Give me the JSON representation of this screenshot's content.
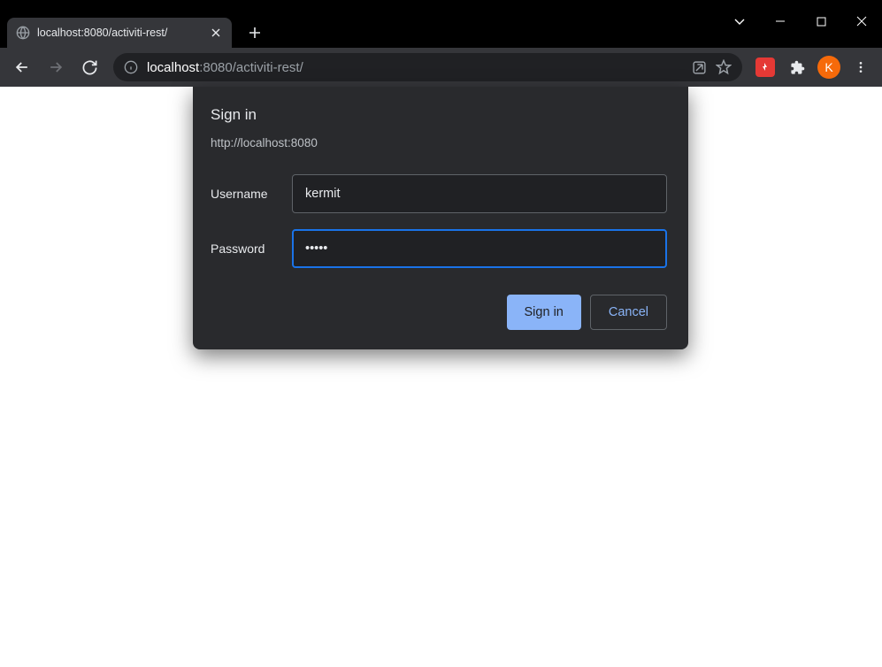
{
  "tab": {
    "title": "localhost:8080/activiti-rest/"
  },
  "omnibox": {
    "host": "localhost",
    "port": ":8080",
    "path": "/activiti-rest/"
  },
  "profile": {
    "initial": "K"
  },
  "auth": {
    "title": "Sign in",
    "origin": "http://localhost:8080",
    "username_label": "Username",
    "username_value": "kermit",
    "password_label": "Password",
    "password_value": "•••••",
    "signin_label": "Sign in",
    "cancel_label": "Cancel"
  }
}
